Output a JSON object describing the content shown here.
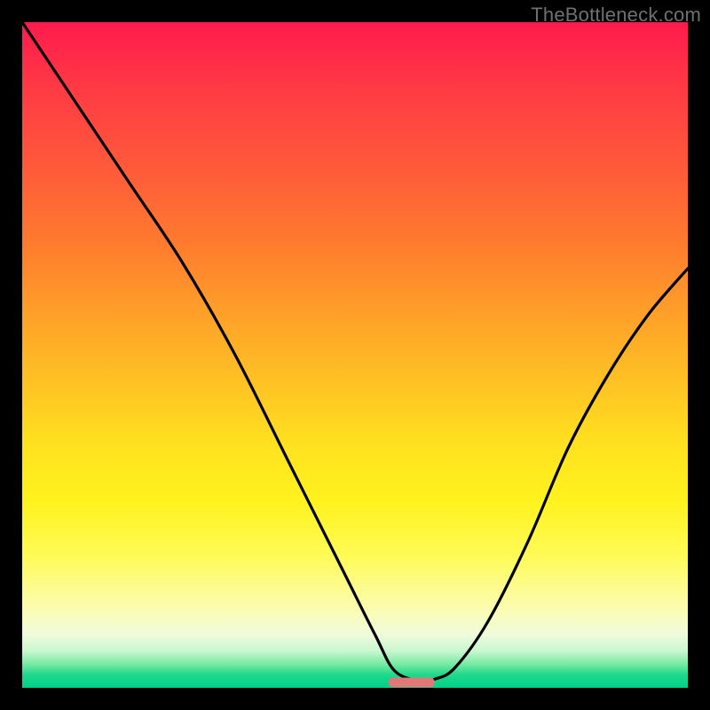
{
  "watermark": "TheBottleneck.com",
  "chart_data": {
    "type": "line",
    "title": "",
    "xlabel": "",
    "ylabel": "",
    "xlim": [
      0,
      100
    ],
    "ylim": [
      0,
      100
    ],
    "series": [
      {
        "name": "curve",
        "x": [
          0,
          8,
          16,
          24,
          32,
          40,
          48,
          53,
          56,
          60,
          62,
          65,
          70,
          76,
          82,
          88,
          94,
          100
        ],
        "y": [
          100,
          88,
          76,
          64,
          50,
          34,
          18,
          8,
          2.5,
          1.0,
          1.3,
          3.0,
          10,
          22,
          36,
          47,
          56,
          63
        ]
      },
      {
        "name": "base-marker",
        "x": [
          55,
          62
        ],
        "y": [
          0.8,
          0.8
        ]
      }
    ],
    "gradient_stops": [
      {
        "pos": 0,
        "color": "#ff1a4d"
      },
      {
        "pos": 45,
        "color": "#ffa428"
      },
      {
        "pos": 72,
        "color": "#fff21e"
      },
      {
        "pos": 96,
        "color": "#74eaa0"
      },
      {
        "pos": 100,
        "color": "#00d188"
      }
    ],
    "marker_color": "#e07878"
  }
}
